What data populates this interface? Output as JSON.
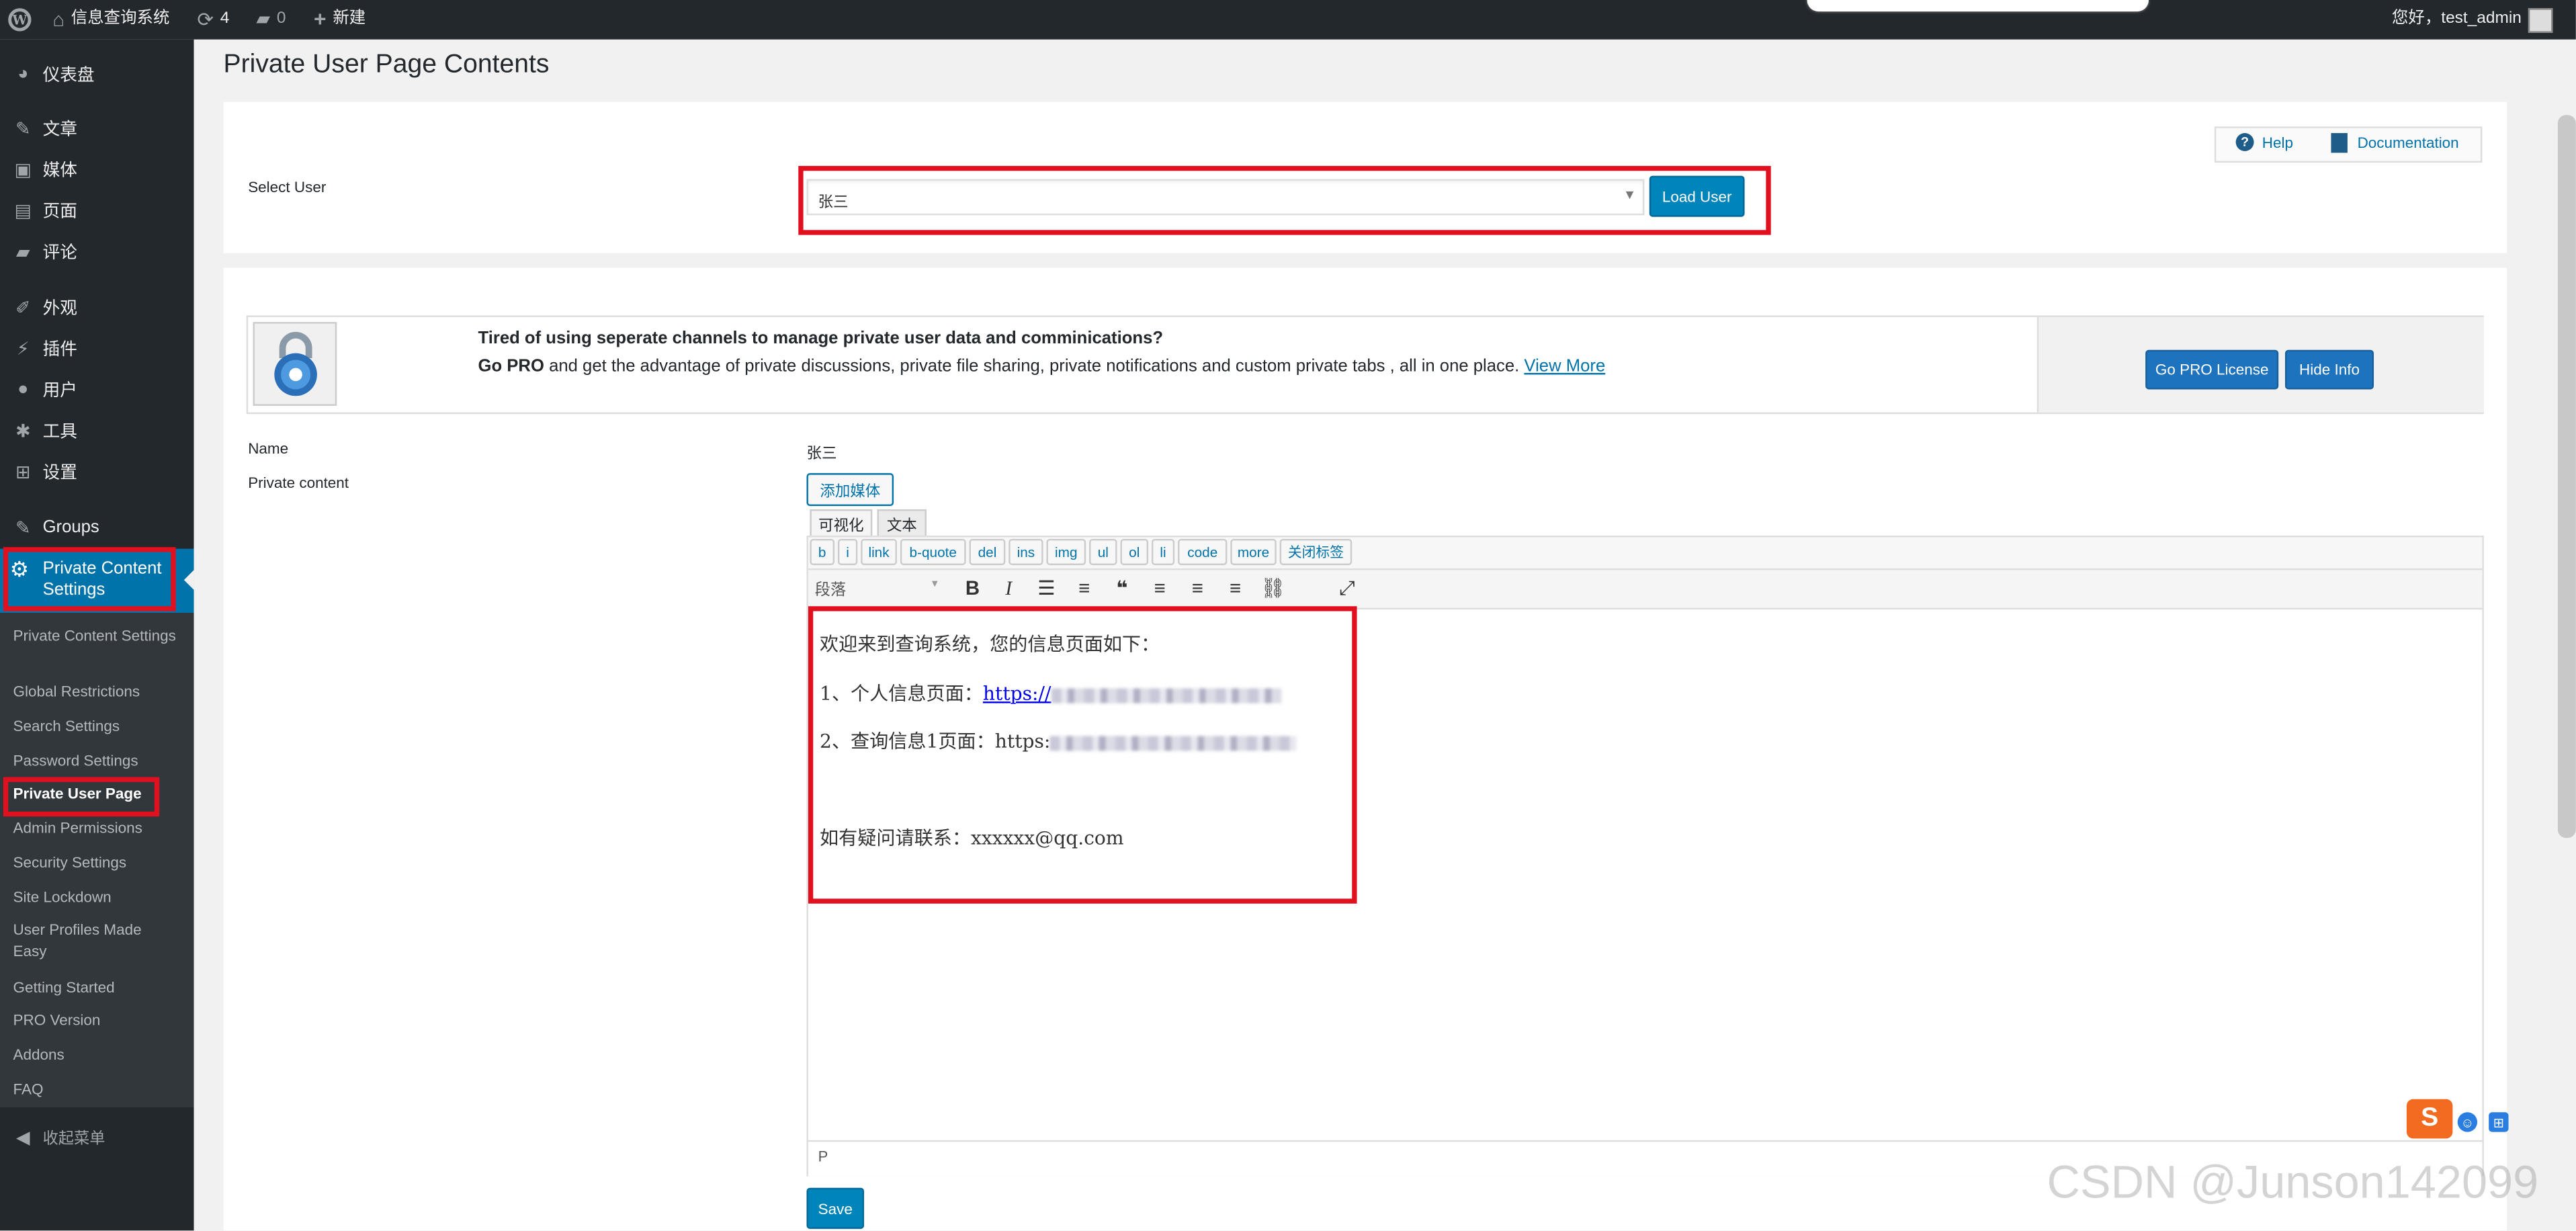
{
  "adminbar": {
    "site_name": "信息查询系统",
    "updates_count": "4",
    "comments_count": "0",
    "new_label": "新建",
    "greeting": "您好，test_admin"
  },
  "sidebar": {
    "items": [
      {
        "label": "仪表盘",
        "icon": "dashboard-icon"
      },
      {
        "label": "文章",
        "icon": "pin-icon"
      },
      {
        "label": "媒体",
        "icon": "media-icon"
      },
      {
        "label": "页面",
        "icon": "page-icon"
      },
      {
        "label": "评论",
        "icon": "comment-icon"
      },
      {
        "label": "外观",
        "icon": "brush-icon"
      },
      {
        "label": "插件",
        "icon": "plugin-icon"
      },
      {
        "label": "用户",
        "icon": "user-icon"
      },
      {
        "label": "工具",
        "icon": "wrench-icon"
      },
      {
        "label": "设置",
        "icon": "settings-icon"
      },
      {
        "label": "Groups",
        "icon": "pin-icon"
      }
    ],
    "active_label": "Private Content Settings",
    "submenu": [
      "Private Content Settings",
      "Global Restrictions",
      "Search Settings",
      "Password Settings",
      "Private User Page",
      "Admin Permissions",
      "Security Settings",
      "Site Lockdown",
      "User Profiles Made Easy",
      "Getting Started",
      "PRO Version",
      "Addons",
      "FAQ"
    ],
    "collapse_label": "收起菜单"
  },
  "page": {
    "title": "Private User Page Contents",
    "help_label": "Help",
    "docs_label": "Documentation",
    "select_user_label": "Select User",
    "selected_user": "张三",
    "load_user_label": "Load User"
  },
  "promo": {
    "headline": "Tired of using seperate channels to manage private user data and comminications?",
    "body_bold": "Go PRO",
    "body_text": " and get the advantage of private discussions, private file sharing, private notifications and custom private tabs , all in one place. ",
    "link_text": "View More",
    "go_pro_label": "Go PRO License",
    "hide_info_label": "Hide Info"
  },
  "form": {
    "name_label": "Name",
    "name_value": "张三",
    "content_label": "Private content",
    "add_media_label": "添加媒体",
    "tab_visual": "可视化",
    "tab_text": "文本",
    "quicktags": [
      "b",
      "i",
      "link",
      "b-quote",
      "del",
      "ins",
      "img",
      "ul",
      "ol",
      "li",
      "code",
      "more",
      "关闭标签"
    ],
    "format_select": "段落",
    "status_path": "P",
    "save_label": "Save"
  },
  "editor": {
    "line1": "欢迎来到查询系统，您的信息页面如下：",
    "line2_prefix": "1、个人信息页面：",
    "line2_link": "https://",
    "line3_prefix": "2、查询信息1页面：",
    "line3_text": "https:",
    "line4": "如有疑问请联系：xxxxxx@qq.com"
  },
  "watermark": "CSDN @Junson142099",
  "colors": {
    "adminbar_bg": "#23282d",
    "active_menu": "#0073aa",
    "button_blue": "#0085ba",
    "highlight_red": "#e0101e"
  }
}
